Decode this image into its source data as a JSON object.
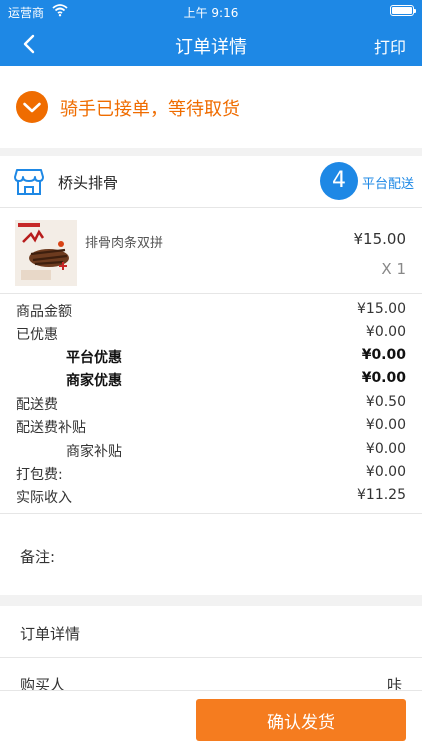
{
  "status_bar": {
    "carrier": "运营商",
    "time": "上午 9:16"
  },
  "nav": {
    "title": "订单详情",
    "print_label": "打印"
  },
  "order_status": {
    "text": "骑手已接单，等待取货",
    "color": "#ef6c00"
  },
  "store": {
    "name": "桥头排骨",
    "badge_number": "4",
    "delivery_type": "平台配送"
  },
  "item": {
    "name": "排骨肉条双拼",
    "price": "¥15.00",
    "quantity": "X 1"
  },
  "summary": [
    {
      "label": "商品金额",
      "value": "¥15.00"
    },
    {
      "label": "已优惠",
      "value": "¥0.00"
    },
    {
      "label": "平台优惠",
      "value": "¥0.00"
    },
    {
      "label": "商家优惠",
      "value": "¥0.00"
    },
    {
      "label": "配送费",
      "value": "¥0.50"
    },
    {
      "label": "配送费补贴",
      "value": "¥0.00"
    },
    {
      "label": "商家补贴",
      "value": "¥0.00"
    },
    {
      "label": "打包费:",
      "value": "¥0.00"
    },
    {
      "label": "实际收入",
      "value": "¥11.25"
    }
  ],
  "remark": {
    "label": "备注:"
  },
  "detail": {
    "header": "订单详情"
  },
  "buyer": {
    "label": "购买人",
    "value": "咔"
  },
  "actions": {
    "confirm_label": "确认发货"
  },
  "colors": {
    "primary": "#1e88e5",
    "accent": "#f57c1f",
    "status": "#ef6c00"
  }
}
